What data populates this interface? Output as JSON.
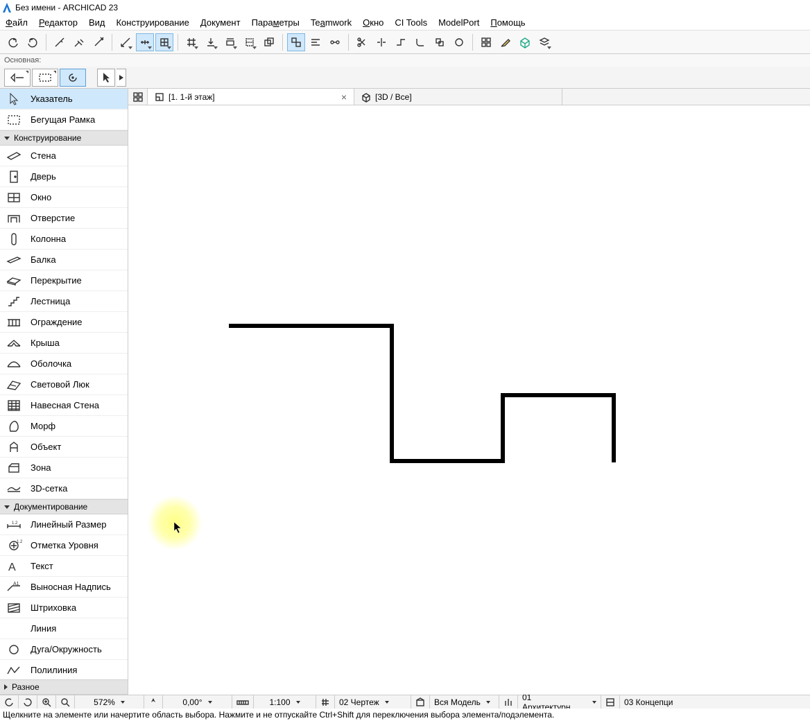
{
  "title": "Без имени - ARCHICAD 23",
  "menu": [
    "Файл",
    "Редактор",
    "Вид",
    "Конструирование",
    "Документ",
    "Параметры",
    "Teamwork",
    "Окно",
    "CI Tools",
    "ModelPort",
    "Помощь"
  ],
  "menu_underline": [
    0,
    0,
    -1,
    -1,
    -1,
    4,
    2,
    0,
    -1,
    -1,
    0
  ],
  "subbar_label": "Основная:",
  "toolbox": {
    "pointer": "Указатель",
    "marquee": "Бегущая Рамка",
    "group_design": "Конструирование",
    "design_items": [
      "Стена",
      "Дверь",
      "Окно",
      "Отверстие",
      "Колонна",
      "Балка",
      "Перекрытие",
      "Лестница",
      "Ограждение",
      "Крыша",
      "Оболочка",
      "Световой Люк",
      "Навесная Стена",
      "Морф",
      "Объект",
      "Зона",
      "3D-сетка"
    ],
    "group_doc": "Документирование",
    "doc_items": [
      "Линейный Размер",
      "Отметка Уровня",
      "Текст",
      "Выносная Надпись",
      "Штриховка",
      "Линия",
      "Дуга/Окружность",
      "Полилиния"
    ],
    "group_misc": "Разное"
  },
  "tabs": {
    "tab1": "[1. 1-й этаж]",
    "tab2": "[3D / Все]"
  },
  "statusbar": {
    "zoom": "572%",
    "angle": "0,00°",
    "scale": "1:100",
    "drawing": "02 Чертеж",
    "model": "Вся Модель",
    "arch": "01 Архитектурн...",
    "concept": "03 Концепци"
  },
  "hint": "Щелкните на элементе или начертите область выбора. Нажмите и не отпускайте Ctrl+Shift для переключения выбора элемента/подэлемента."
}
